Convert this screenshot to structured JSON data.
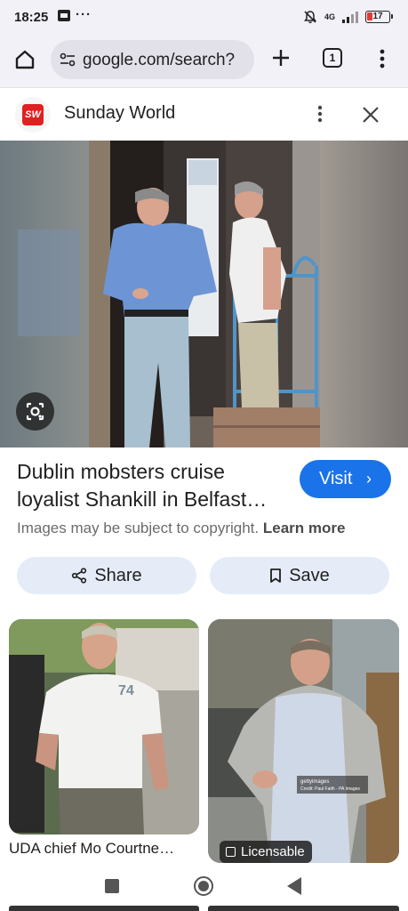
{
  "status_bar": {
    "time": "18:25",
    "network": "4G",
    "battery": "17"
  },
  "browser": {
    "url": "google.com/search?",
    "tab_count": "1"
  },
  "source": {
    "logo_text": "SW",
    "name": "Sunday World"
  },
  "result": {
    "title": "Dublin mobsters cruise loyalist Shankill in Belfast…",
    "visit_label": "Visit",
    "copyright_text": "Images may be subject to copyright.",
    "learn_more": "Learn more",
    "share_label": "Share",
    "save_label": "Save"
  },
  "related": [
    {
      "caption": "UDA chief Mo Courtne…",
      "shirt_number": "74"
    },
    {
      "badge": "Licensable",
      "watermark_line1": "gettyimages",
      "watermark_line2": "Credit: Paul Faith - PA Images"
    }
  ],
  "colors": {
    "accent": "#1a73e8",
    "chip_bg": "#e5ecf8",
    "toolbar_bg": "#f2f1f8",
    "logo_red": "#e02020"
  },
  "icons": [
    "home-icon",
    "tune-icon",
    "plus-icon",
    "more-vert-icon",
    "close-icon",
    "lens-icon",
    "share-icon",
    "bookmark-icon",
    "image-icon"
  ]
}
